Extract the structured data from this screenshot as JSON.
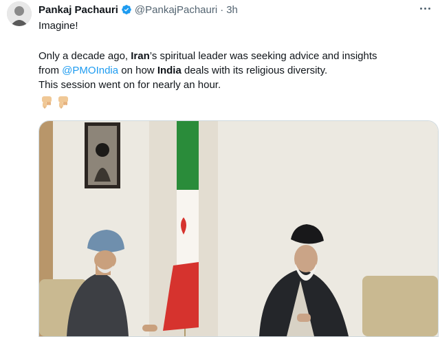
{
  "tweet": {
    "author_name": "Pankaj Pachauri",
    "handle": "@PankajPachauri",
    "separator": "·",
    "time": "3h",
    "line1": "Imagine!",
    "body": {
      "p1_before": "Only a decade ago, ",
      "p1_bold1": "Iran",
      "p1_mid": "’s spiritual leader was seeking advice and insights",
      "p2_before": "from ",
      "p2_mention": "@PMOIndia",
      "p2_mid": " on how ",
      "p2_bold2": "India",
      "p2_after": " deals with its religious diversity.",
      "p3": "This session went on for nearly an hour."
    }
  },
  "icons": {
    "verified": "verified-badge-icon",
    "more": "more-options-icon",
    "emoji": "backhand-index-pointing-down-emoji"
  },
  "colors": {
    "link": "#1d9bf0",
    "secondary_text": "#536471",
    "verified": "#1d9bf0"
  }
}
